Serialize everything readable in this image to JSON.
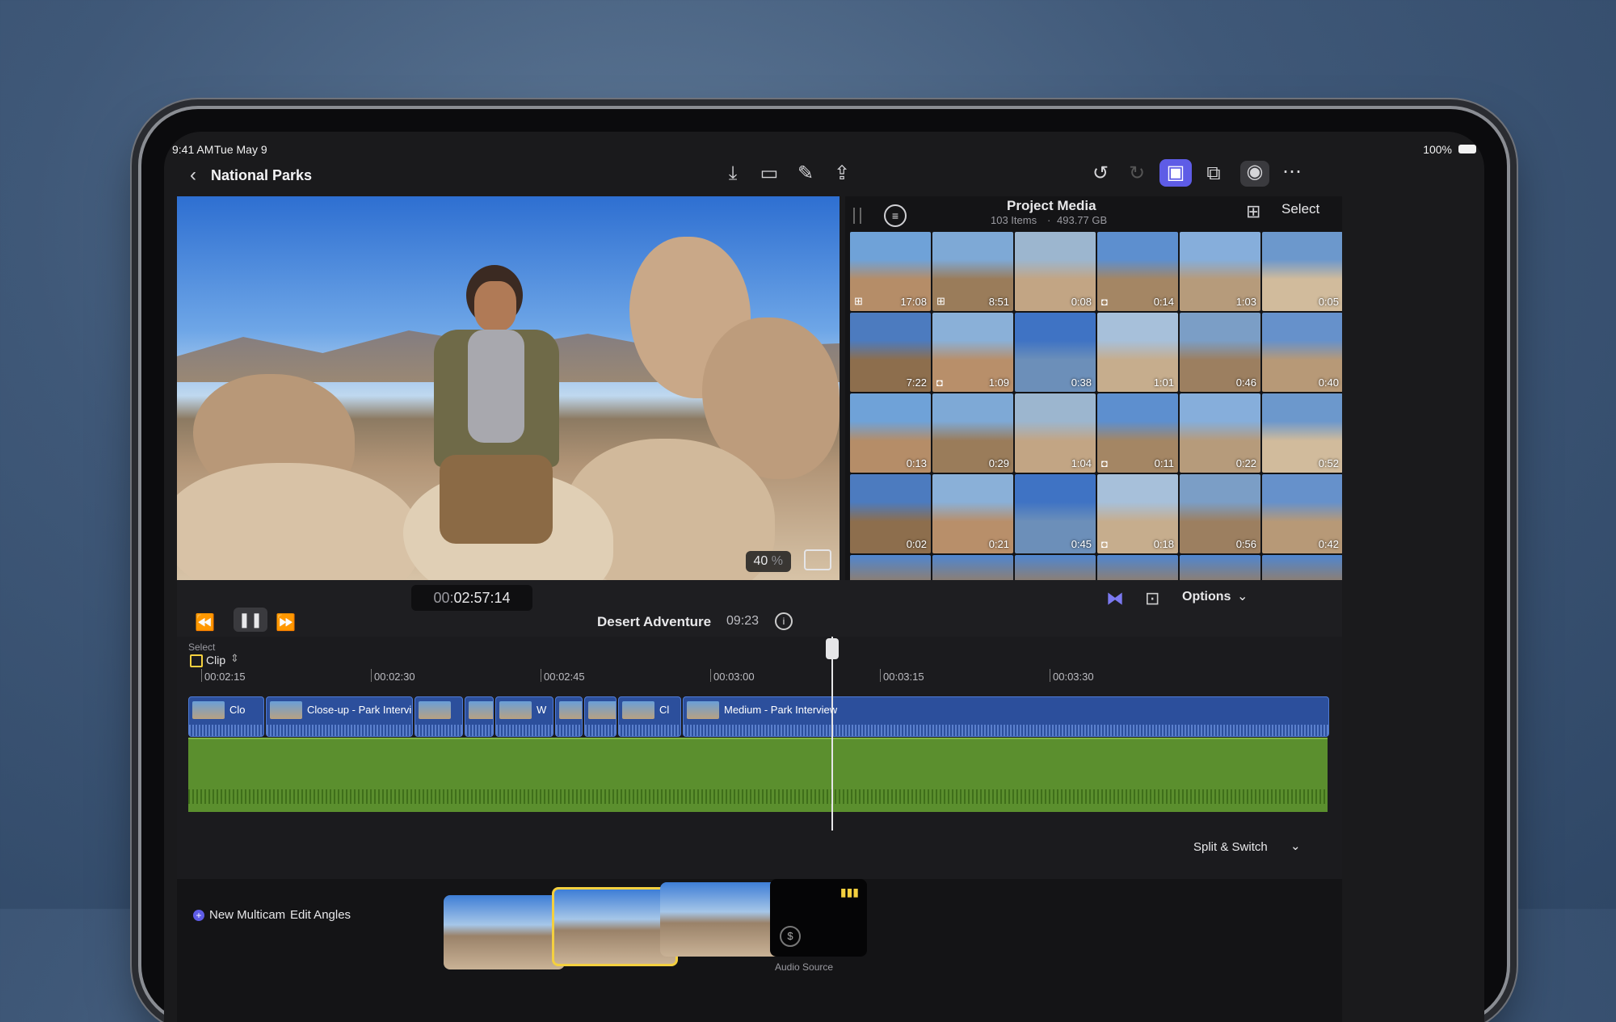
{
  "status_bar": {
    "time": "9:41 AM",
    "date": "Tue May 9",
    "battery": "100%"
  },
  "header": {
    "back_icon": "chevron-left-icon",
    "project_title": "National Parks"
  },
  "toolbar": {
    "left_icons": [
      "import-icon",
      "camera-icon",
      "pencil-icon",
      "share-icon"
    ],
    "right_icons": [
      "undo-icon",
      "redo-icon",
      "photos-icon",
      "effects-icon",
      "voiceover-icon",
      "more-icon"
    ]
  },
  "viewer": {
    "zoom_value": "40",
    "zoom_unit": "%"
  },
  "browser": {
    "title": "Project Media",
    "item_count": "103 Items",
    "separator": "·",
    "size": "493.77 GB",
    "select_label": "Select",
    "options_label": "Options",
    "thumbnails": [
      {
        "duration": "17:08",
        "badge": "multicam"
      },
      {
        "duration": "8:51",
        "badge": "multicam"
      },
      {
        "duration": "0:08",
        "badge": ""
      },
      {
        "duration": "0:14",
        "badge": "camera"
      },
      {
        "duration": "1:03",
        "badge": ""
      },
      {
        "duration": "0:05",
        "badge": ""
      },
      {
        "duration": "7:22",
        "badge": ""
      },
      {
        "duration": "1:09",
        "badge": "camera"
      },
      {
        "duration": "0:38",
        "badge": ""
      },
      {
        "duration": "1:01",
        "badge": ""
      },
      {
        "duration": "0:46",
        "badge": ""
      },
      {
        "duration": "0:40",
        "badge": ""
      },
      {
        "duration": "0:13",
        "badge": ""
      },
      {
        "duration": "0:29",
        "badge": ""
      },
      {
        "duration": "1:04",
        "badge": ""
      },
      {
        "duration": "0:11",
        "badge": "camera"
      },
      {
        "duration": "0:22",
        "badge": ""
      },
      {
        "duration": "0:52",
        "badge": ""
      },
      {
        "duration": "0:02",
        "badge": ""
      },
      {
        "duration": "0:21",
        "badge": ""
      },
      {
        "duration": "0:45",
        "badge": ""
      },
      {
        "duration": "0:18",
        "badge": "camera"
      },
      {
        "duration": "0:56",
        "badge": ""
      },
      {
        "duration": "0:42",
        "badge": ""
      }
    ]
  },
  "transport": {
    "timecode_prefix": "00:",
    "timecode_main": "02:57",
    "timecode_frames": ":14",
    "project_name": "Desert Adventure",
    "project_duration": "09:23"
  },
  "timeline": {
    "select_label": "Select",
    "mode_label": "Clip",
    "ruler": [
      "00:02:15",
      "00:02:30",
      "00:02:45",
      "00:03:00",
      "00:03:15",
      "00:03:30"
    ],
    "clips": [
      {
        "label": "Clo"
      },
      {
        "label": "Close-up - Park Interview"
      },
      {
        "label": ""
      },
      {
        "label": ""
      },
      {
        "label": "W"
      },
      {
        "label": ""
      },
      {
        "label": ""
      },
      {
        "label": "Cl"
      },
      {
        "label": "Medium - Park Interview"
      }
    ],
    "split_switch_label": "Split & Switch"
  },
  "multicam": {
    "new_multicam_label": "New Multicam",
    "edit_angles_label": "Edit Angles",
    "audio_source_label": "Audio Source"
  },
  "colors": {
    "accent": "#5e5ce6",
    "clip_blue": "#2c4f9c",
    "audio_green": "#5b8f2e",
    "selected_yellow": "#f4d03f"
  }
}
